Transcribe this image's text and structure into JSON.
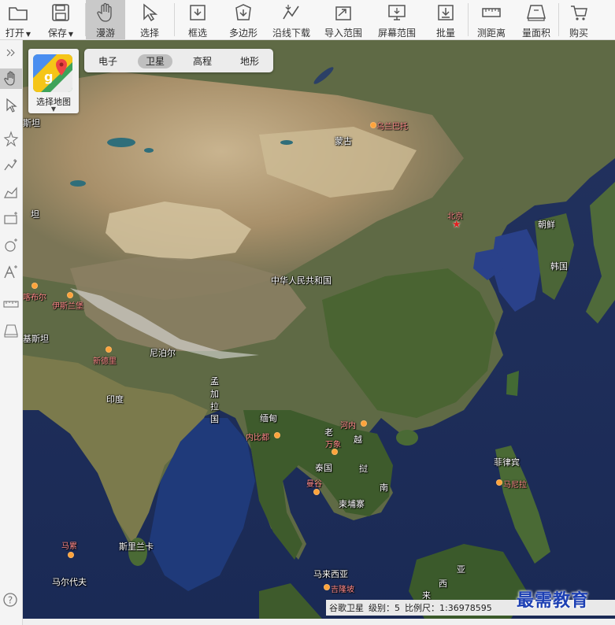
{
  "toolbar": {
    "items": [
      {
        "label": "打开",
        "icon": "folder-icon",
        "dropdown": true
      },
      {
        "label": "保存",
        "icon": "save-icon",
        "dropdown": true
      },
      {
        "label": "漫游",
        "icon": "hand-icon",
        "active": true
      },
      {
        "label": "选择",
        "icon": "cursor-icon"
      },
      {
        "label": "框选",
        "icon": "frame-select-icon"
      },
      {
        "label": "多边形",
        "icon": "polygon-download-icon"
      },
      {
        "label": "沿线下载",
        "icon": "line-download-icon"
      },
      {
        "label": "导入范围",
        "icon": "import-range-icon"
      },
      {
        "label": "屏幕范围",
        "icon": "screen-range-icon"
      },
      {
        "label": "批量",
        "icon": "batch-icon"
      },
      {
        "label": "测距离",
        "icon": "ruler-icon"
      },
      {
        "label": "量面积",
        "icon": "area-measure-icon"
      },
      {
        "label": "购买",
        "icon": "cart-icon"
      }
    ]
  },
  "map_source": {
    "label": "选择地图"
  },
  "map_tabs": [
    {
      "label": "电子"
    },
    {
      "label": "卫星",
      "active": true
    },
    {
      "label": "高程"
    },
    {
      "label": "地形"
    }
  ],
  "map_labels": {
    "mongolia": "蒙古",
    "china": "中华人民共和国",
    "nkorea": "朝鲜",
    "skorea": "韩国",
    "nepal": "尼泊尔",
    "bangladesh": [
      "孟",
      "加",
      "拉",
      "国"
    ],
    "india": "印度",
    "myanmar": "缅甸",
    "laos": "老",
    "vietnam": "越",
    "thailand": "泰国",
    "cambodia": "柬埔寨",
    "cambodia2": "挝",
    "south": "南",
    "philippines": "菲律宾",
    "srilanka": "斯里兰卡",
    "maldives": "马尔代夫",
    "malaysia": "马来西亚",
    "malay2": "亚",
    "west": "西",
    "lai": "来",
    "tan1": "斯坦",
    "tan2": "坦",
    "pakistan_frag": "基斯坦"
  },
  "city_labels": {
    "ulaanbaatar": "乌兰巴托",
    "beijing": "北京",
    "islamabad": "伊斯兰堡",
    "newdelhi": "新德里",
    "hanoi": "河内",
    "naypyidaw": "内比都",
    "vientiane": "万象",
    "bangkok": "曼谷",
    "manila": "马尼拉",
    "male": "马累",
    "kualalumpur": "吉隆坡",
    "kabul_frag": "喀布尔"
  },
  "status": {
    "source": "谷歌卫星",
    "level_label": "级别：",
    "level": "5",
    "scale_label": "比例尺：",
    "scale": "1:36978595"
  },
  "watermark": "最需教育",
  "colors": {
    "accent_active": "#c9c9c9",
    "city_dot": "#ffa33a",
    "city_text": "#ff8a8a",
    "capital_star": "#e02020",
    "watermark": "#1c3fb3"
  }
}
